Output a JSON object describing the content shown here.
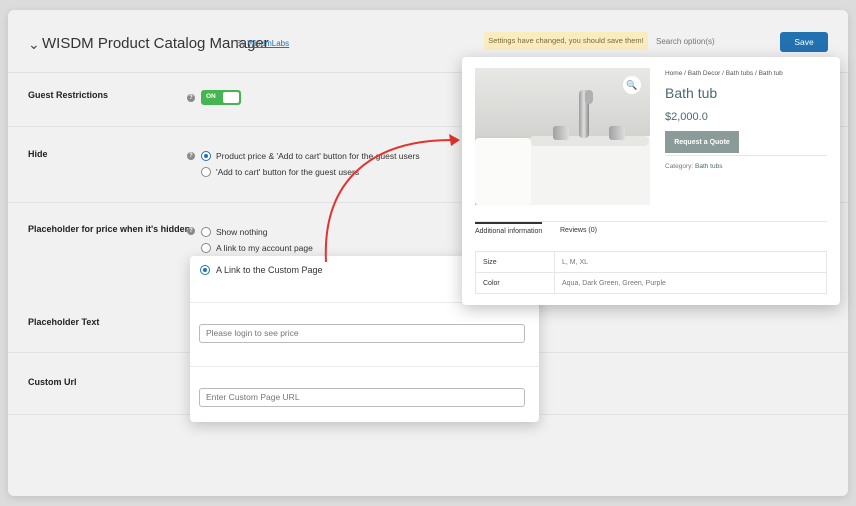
{
  "header": {
    "logo_glyph": "⌄",
    "title": "WISDM Product Catalog Manager",
    "by_label": "By",
    "by_link": "WisdmLabs",
    "notice": "Settings have changed, you should save them!",
    "search_placeholder": "Search option(s)",
    "save_label": "Save"
  },
  "settings": {
    "guest_restrictions": {
      "label": "Guest Restrictions",
      "toggle_label": "ON",
      "toggle_on": true
    },
    "hide": {
      "label": "Hide",
      "options": [
        "Product price & 'Add to cart' button for the guest users",
        "'Add to cart' button for the guest users"
      ],
      "selected_index": 0
    },
    "placeholder_price": {
      "label": "Placeholder for price when it's hidden",
      "options": [
        "Show nothing",
        "A link to my account page",
        "A Link to the Custom Page"
      ],
      "selected_index": 2
    },
    "placeholder_text": {
      "label": "Placeholder Text",
      "placeholder": "Please login to see price"
    },
    "custom_url": {
      "label": "Custom Url",
      "placeholder": "Enter Custom Page URL"
    }
  },
  "product": {
    "breadcrumb": "Home / Bath Decor / Bath tubs / Bath tub",
    "title": "Bath tub",
    "price": "$2,000.0",
    "quote_button": "Request a Quote",
    "category_label": "Category:",
    "category_value": "Bath tubs",
    "tabs": [
      "Additional information",
      "Reviews (0)"
    ],
    "attributes": [
      {
        "name": "Size",
        "value": "L, M, XL"
      },
      {
        "name": "Color",
        "value": "Aqua, Dark Green, Green, Purple"
      }
    ],
    "zoom_glyph": "🔍"
  },
  "colors": {
    "accent": "#2271b1",
    "toggle_on": "#46b450",
    "arrow": "#e2332e",
    "notice_bg": "#fbecc0"
  }
}
